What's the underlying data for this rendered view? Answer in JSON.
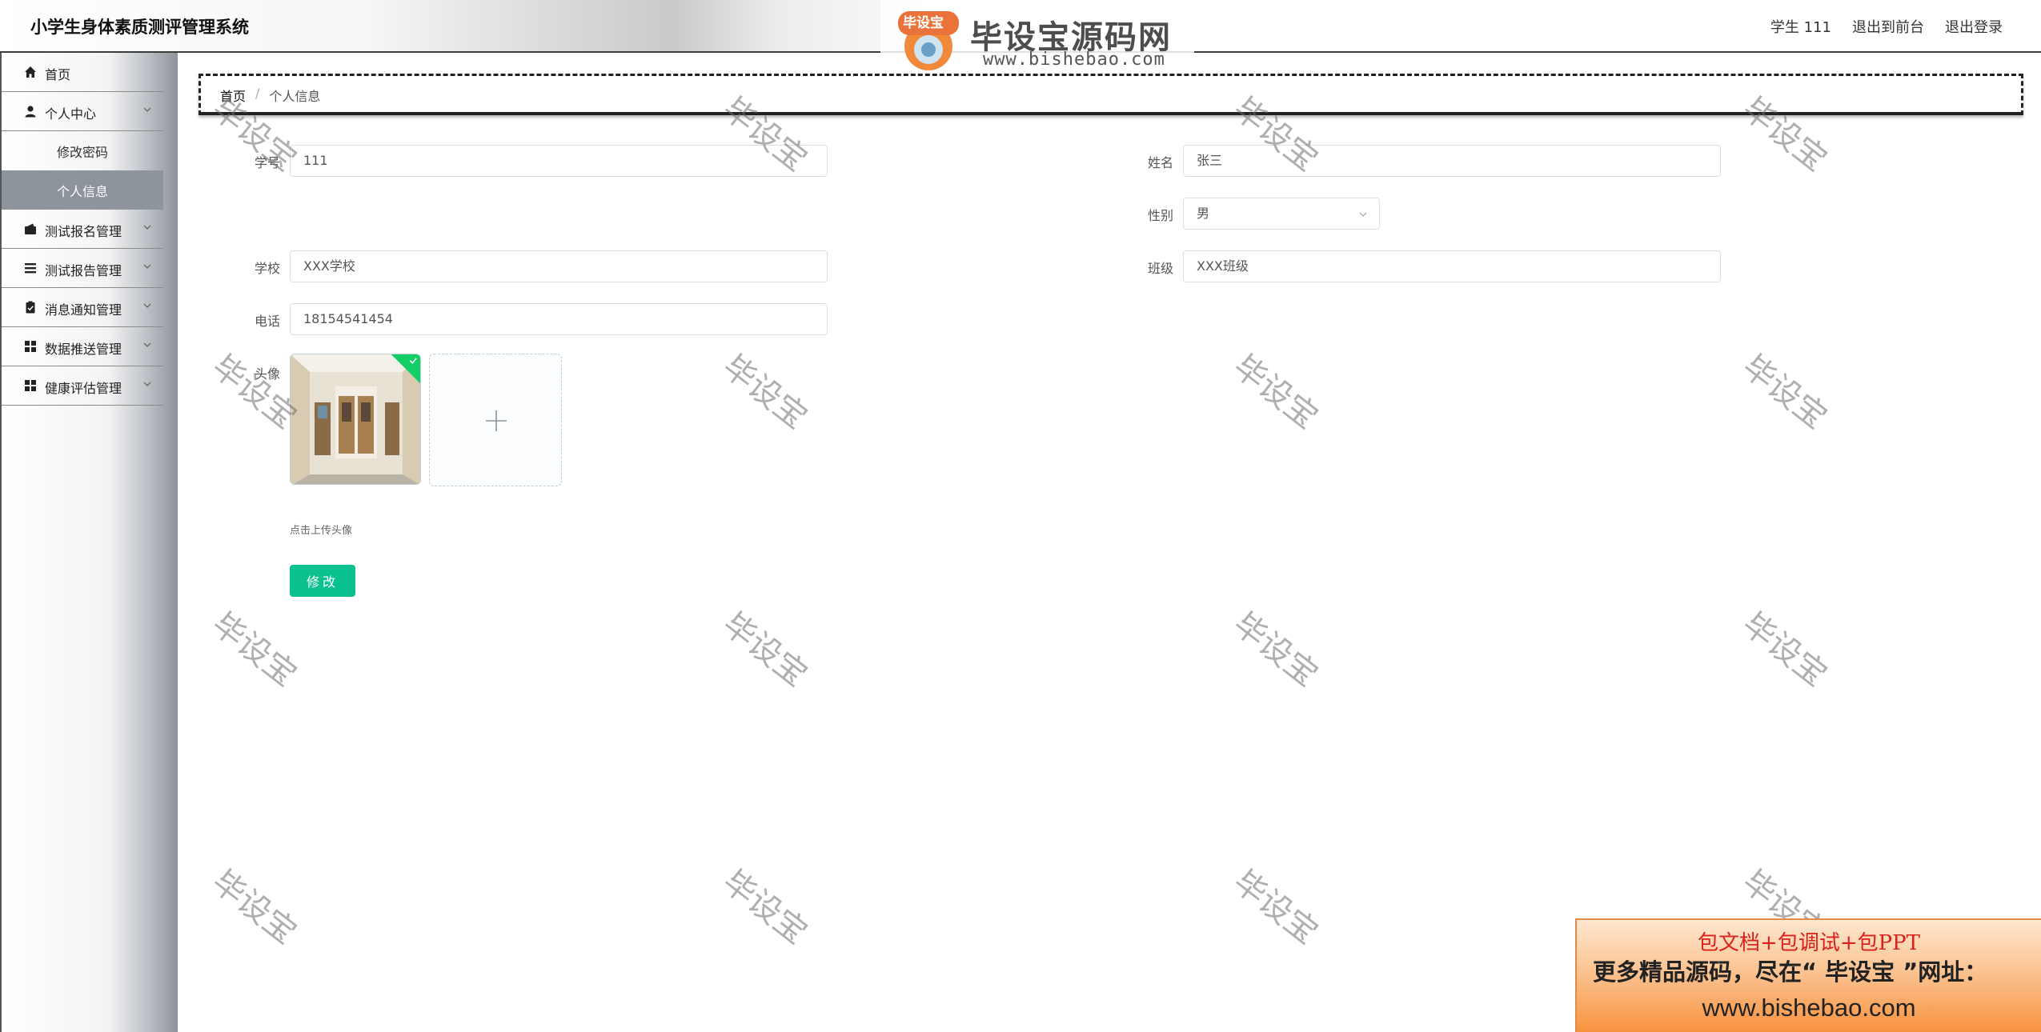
{
  "header": {
    "title": "小学生身体素质测评管理系统",
    "user": "学生 111",
    "back_to_front": "退出到前台",
    "logout": "退出登录"
  },
  "brand": {
    "badge_text": "毕设宝",
    "name": "毕设宝源码网",
    "url": "www.bishebao.com"
  },
  "sidebar": {
    "items": [
      {
        "label": "首页",
        "icon": "home-icon"
      },
      {
        "label": "个人中心",
        "icon": "user-icon",
        "expanded": true,
        "children": [
          {
            "label": "修改密码"
          },
          {
            "label": "个人信息",
            "active": true
          }
        ]
      },
      {
        "label": "测试报名管理",
        "icon": "wallet-icon"
      },
      {
        "label": "测试报告管理",
        "icon": "list-icon"
      },
      {
        "label": "消息通知管理",
        "icon": "clipboard-icon"
      },
      {
        "label": "数据推送管理",
        "icon": "grid-icon"
      },
      {
        "label": "健康评估管理",
        "icon": "grid-icon"
      }
    ]
  },
  "breadcrumb": {
    "home": "首页",
    "separator": "/",
    "current": "个人信息"
  },
  "form": {
    "student_id": {
      "label": "学号",
      "value": "111"
    },
    "name": {
      "label": "姓名",
      "value": "张三"
    },
    "gender": {
      "label": "性别",
      "value": "男"
    },
    "school": {
      "label": "学校",
      "value": "XXX学校"
    },
    "class": {
      "label": "班级",
      "value": "XXX班级"
    },
    "phone": {
      "label": "电话",
      "value": "18154541454"
    },
    "avatar": {
      "label": "头像",
      "hint": "点击上传头像"
    },
    "submit_label": "修改"
  },
  "watermark_text": "毕设宝",
  "promo": {
    "line1": "包文档+包调试+包PPT",
    "line2": "更多精品源码，尽在“ 毕设宝 ”网址：",
    "line3": "www.bishebao.com"
  },
  "colors": {
    "accent": "#0bc28f",
    "active_menu": "#8e949c",
    "success": "#13ce66"
  }
}
